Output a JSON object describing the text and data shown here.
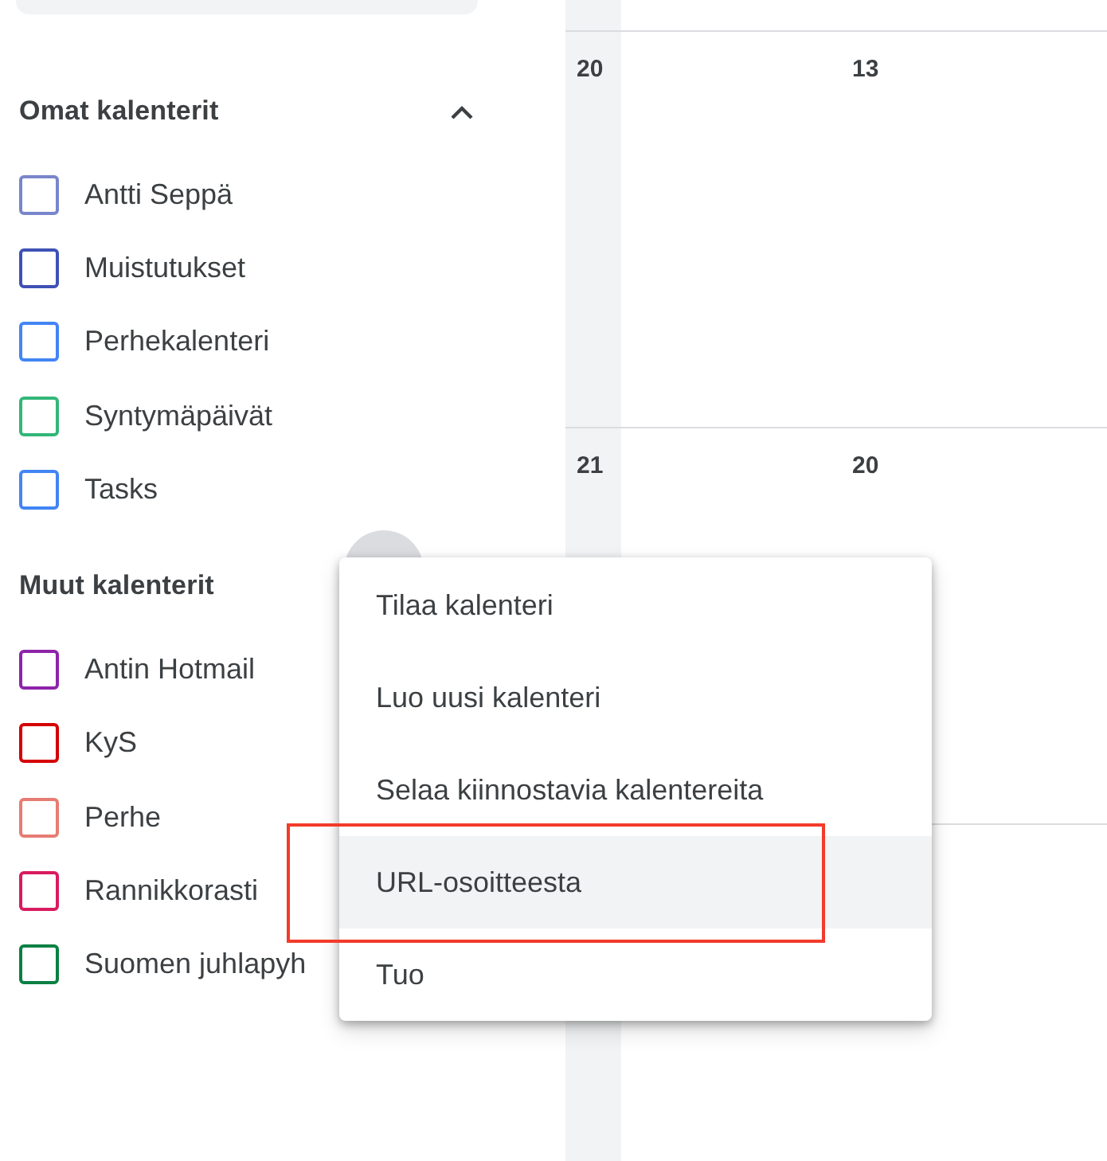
{
  "sidebar": {
    "sections": [
      {
        "title": "Omat kalenterit",
        "expanded": true,
        "calendars": [
          {
            "label": "Antti Seppä",
            "checked": false,
            "color": "#7986cb"
          },
          {
            "label": "Muistutukset",
            "checked": false,
            "color": "#3f51b5"
          },
          {
            "label": "Perhekalenteri",
            "checked": false,
            "color": "#4285f4"
          },
          {
            "label": "Syntymäpäivät",
            "checked": false,
            "color": "#33b679"
          },
          {
            "label": "Tasks",
            "checked": false,
            "color": "#4285f4"
          }
        ]
      },
      {
        "title": "Muut kalenterit",
        "calendars": [
          {
            "label": "Antin Hotmail",
            "checked": false,
            "color": "#8e24aa"
          },
          {
            "label": "KyS",
            "checked": false,
            "color": "#d50000"
          },
          {
            "label": "Perhe",
            "checked": false,
            "color": "#e67c73"
          },
          {
            "label": "Rannikkorasti",
            "checked": false,
            "color": "#d81b60"
          },
          {
            "label": "Suomen juhlapyh",
            "checked": false,
            "color": "#0b8043"
          }
        ]
      }
    ]
  },
  "calendar": {
    "weeks": [
      {
        "week": "20",
        "day": "13"
      },
      {
        "week": "21",
        "day": "20"
      }
    ]
  },
  "menu": {
    "items": [
      {
        "label": "Tilaa kalenteri",
        "selected": false
      },
      {
        "label": "Luo uusi kalenteri",
        "selected": false
      },
      {
        "label": "Selaa kiinnostavia kalentereita",
        "selected": false
      },
      {
        "label": "URL-osoitteesta",
        "selected": true
      },
      {
        "label": "Tuo",
        "selected": false
      }
    ]
  }
}
